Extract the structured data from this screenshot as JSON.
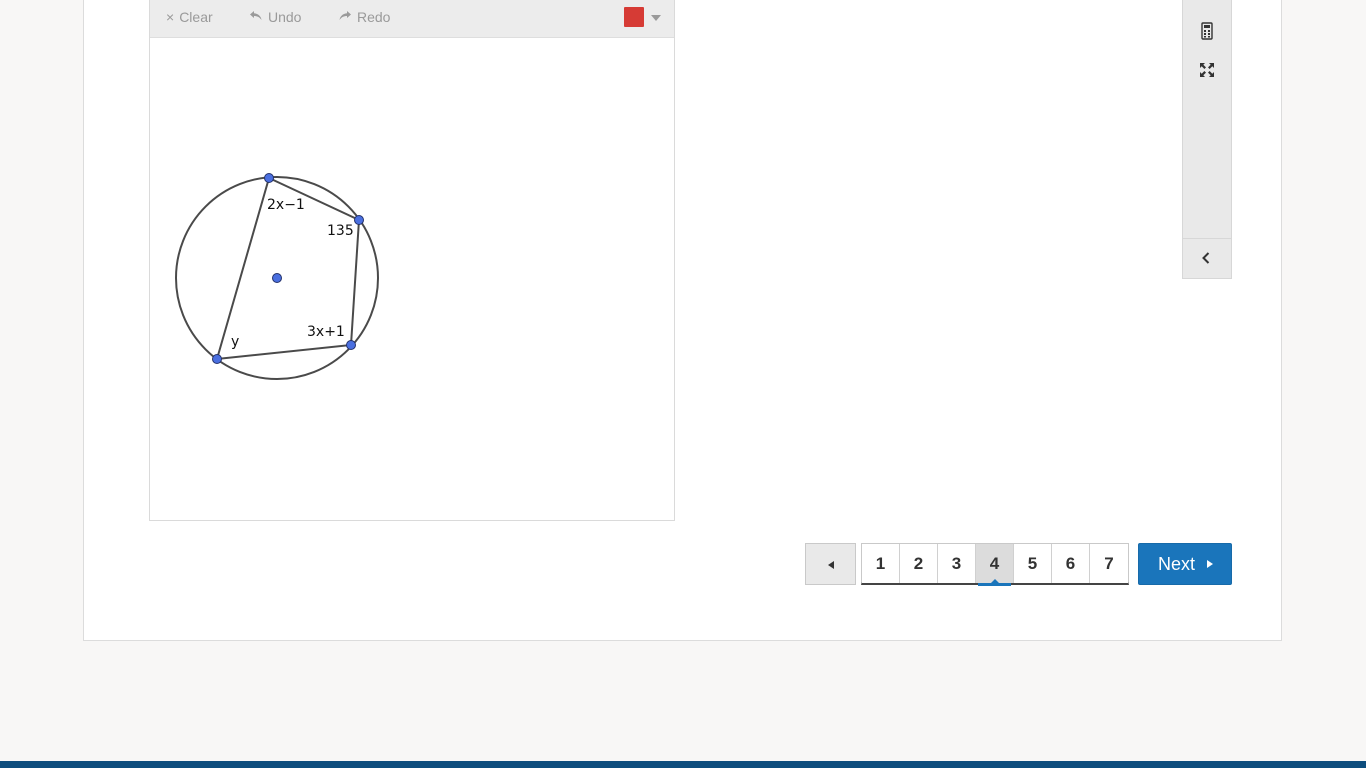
{
  "toolbar": {
    "clear_label": "Clear",
    "undo_label": "Undo",
    "redo_label": "Redo",
    "clear_icon": "×",
    "pen_color": "#d63b35"
  },
  "figure": {
    "labels": {
      "top": "2x−1",
      "right_upper": "135",
      "right_lower": "3x+1",
      "left_lower": "y"
    }
  },
  "side_tools": {
    "icons": [
      "calculator-icon",
      "fullscreen-icon",
      "chevron-left-icon"
    ]
  },
  "pagination": {
    "pages": [
      "1",
      "2",
      "3",
      "4",
      "5",
      "6",
      "7"
    ],
    "current": "4",
    "next_label": "Next"
  },
  "colors": {
    "accent": "#1a75bb",
    "footer": "#0d4d7d"
  }
}
